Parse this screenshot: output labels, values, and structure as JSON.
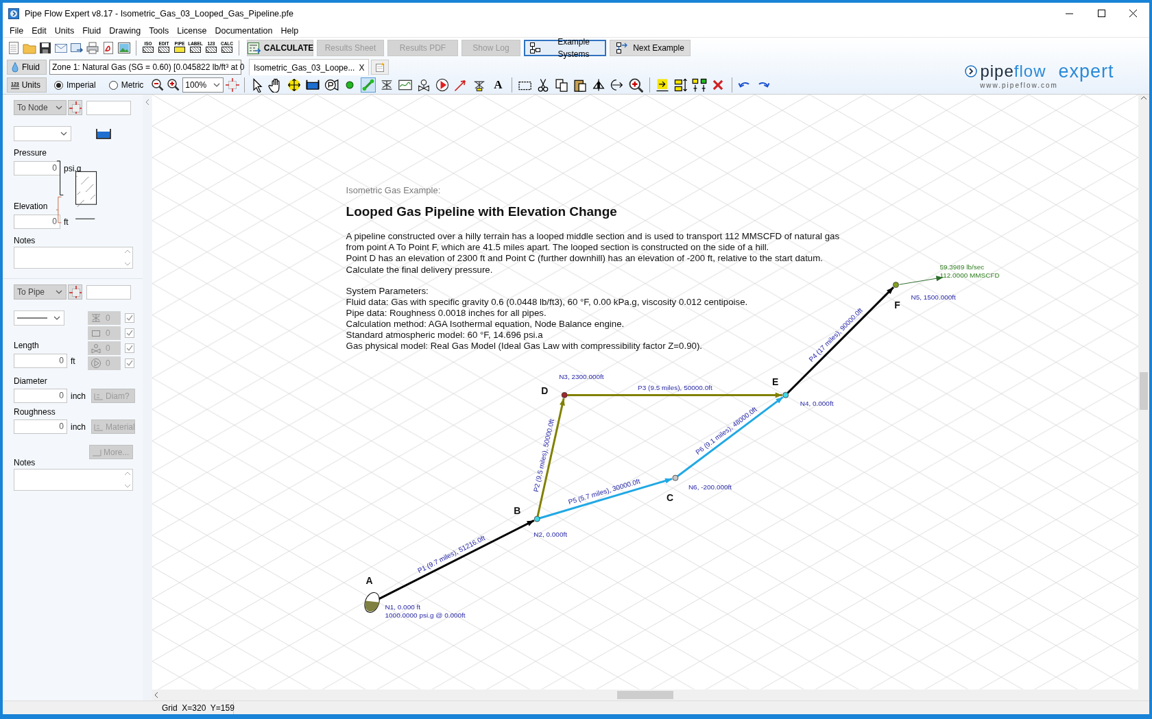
{
  "window": {
    "title": "Pipe Flow Expert v8.17 - Isometric_Gas_03_Looped_Gas_Pipeline.pfe"
  },
  "menu": [
    "File",
    "Edit",
    "Units",
    "Fluid",
    "Drawing",
    "Tools",
    "License",
    "Documentation",
    "Help"
  ],
  "toolbar": {
    "file_tools": [
      {
        "kind": "new"
      },
      {
        "kind": "open"
      },
      {
        "kind": "save"
      },
      {
        "kind": "email"
      },
      {
        "kind": "export"
      },
      {
        "kind": "print"
      },
      {
        "kind": "pdf"
      },
      {
        "kind": "image"
      }
    ],
    "mode_tools": [
      "ISO",
      "EDIT",
      "PIPE",
      "LABEL",
      "123",
      "CALC"
    ],
    "buttons": [
      {
        "label": "CALCULATE",
        "kind": "calculate",
        "disabled": false,
        "focused": false
      },
      {
        "label": "Results Sheet",
        "kind": "plain",
        "disabled": true,
        "focused": false
      },
      {
        "label": "Results PDF",
        "kind": "plain",
        "disabled": true,
        "focused": false
      },
      {
        "label": "Show Log",
        "kind": "plain",
        "disabled": true,
        "focused": false
      },
      {
        "label": "Example Systems",
        "kind": "systems",
        "disabled": false,
        "focused": true
      },
      {
        "label": "Next Example",
        "kind": "next",
        "disabled": false,
        "focused": false
      }
    ]
  },
  "fluid_bar": {
    "button": "Fluid",
    "zone": "Zone 1: Natural Gas (SG = 0.60) [0.045822 lb/ft³ at 0"
  },
  "tabs": [
    {
      "label": "Isometric_Gas_03_Loope...",
      "close": "X",
      "selected": true
    }
  ],
  "units_bar": {
    "icon_text": "123",
    "button": "Units",
    "radios": [
      {
        "label": "Imperial",
        "selected": true
      },
      {
        "label": "Metric",
        "selected": false
      }
    ],
    "zoom": "100%"
  },
  "draw_tools": [
    {
      "kind": "pointer",
      "selected": false
    },
    {
      "kind": "hand",
      "selected": false
    },
    {
      "kind": "move",
      "selected": false
    },
    {
      "kind": "tank",
      "selected": false
    },
    {
      "kind": "compressor",
      "selected": false
    },
    {
      "kind": "node",
      "selected": false
    },
    {
      "kind": "pipe",
      "selected": true
    },
    {
      "kind": "valve",
      "selected": false
    },
    {
      "kind": "curve",
      "selected": false
    },
    {
      "kind": "control",
      "selected": false
    },
    {
      "kind": "pump",
      "selected": false
    },
    {
      "kind": "leader",
      "selected": false
    },
    {
      "kind": "component",
      "selected": false
    },
    {
      "kind": "text",
      "glyph": "A",
      "selected": false
    },
    {
      "kind": "sep"
    },
    {
      "kind": "select",
      "selected": false
    },
    {
      "kind": "cut",
      "selected": false
    },
    {
      "kind": "copy",
      "selected": false
    },
    {
      "kind": "paste",
      "selected": false
    },
    {
      "kind": "flip",
      "selected": false
    },
    {
      "kind": "rotate",
      "selected": false
    },
    {
      "kind": "zoomarea",
      "selected": false
    },
    {
      "kind": "sep"
    },
    {
      "kind": "insert",
      "selected": false
    },
    {
      "kind": "align",
      "selected": false
    },
    {
      "kind": "spread",
      "selected": false
    },
    {
      "kind": "delete",
      "selected": false
    },
    {
      "kind": "sep"
    },
    {
      "kind": "undo",
      "selected": false
    },
    {
      "kind": "redo",
      "selected": false
    }
  ],
  "logo": {
    "part1": "pipe",
    "part2": "flow",
    "part3": "expert",
    "url": "www.pipeflow.com"
  },
  "node_panel": {
    "mode": "To Node",
    "pressure_label": "Pressure",
    "pressure": "0",
    "pressure_unit": "psi.g",
    "elevation_label": "Elevation",
    "elevation": "0",
    "elevation_unit": "ft",
    "notes_label": "Notes"
  },
  "pipe_panel": {
    "mode": "To Pipe",
    "fittings": [
      {
        "kind": "valve",
        "count": "0",
        "checked": true
      },
      {
        "kind": "fitting",
        "count": "0",
        "checked": true
      },
      {
        "kind": "control",
        "count": "0",
        "checked": true
      },
      {
        "kind": "pump",
        "count": "0",
        "checked": true
      }
    ],
    "length_label": "Length",
    "length": "0",
    "length_unit": "ft",
    "diameter_label": "Diameter",
    "diameter": "0",
    "diameter_unit": "inch",
    "diam_button": "Diam?",
    "roughness_label": "Roughness",
    "roughness": "0",
    "roughness_unit": "inch",
    "material_button": "Material",
    "more_button": "More...",
    "notes_label": "Notes"
  },
  "diagram": {
    "intro": "Isometric Gas Example:",
    "heading": "Looped Gas Pipeline with Elevation Change",
    "description": [
      "A pipeline constructed over a hilly terrain has a looped middle section and is used to transport 112 MMSCFD of natural gas",
      "from point A To Point F, which are 41.5 miles apart. The looped section is constructed on the side of a hill.",
      "Point D has an elevation of 2300 ft and Point C (further downhill) has an elevation of -200 ft, relative to the start datum.",
      "Calculate the final delivery pressure."
    ],
    "params_heading": "System Parameters:",
    "params": [
      "Fluid data: Gas with specific gravity 0.6 (0.0448 lb/ft3), 60 °F, 0.00 kPa.g, viscosity 0.012 centipoise.",
      "Pipe data: Roughness 0.0018 inches for all pipes.",
      "Calculation method: AGA Isothermal equation, Node Balance engine.",
      "Standard atmospheric model: 60 °F, 14.696 psi.a",
      "Gas physical model: Real Gas Model (Ideal Gas Law with compressibility factor Z=0.90)."
    ],
    "nodes": [
      {
        "kind": "tank",
        "letter": "A",
        "label": "N1, 0.000 ft",
        "label2": "1000.0000 psi.g @ 0.000ft",
        "color": "#808040"
      },
      {
        "kind": "node",
        "letter": "B",
        "label": "N2, 0.000ft",
        "color": "#40d8e8"
      },
      {
        "kind": "node",
        "letter": "D",
        "label": "N3, 2300.000ft",
        "color": "#a02828"
      },
      {
        "kind": "node",
        "letter": "E",
        "label": "N4, 0.000ft",
        "color": "#40d8e8"
      },
      {
        "kind": "node",
        "letter": "F",
        "label": "N5, 1500.000ft",
        "color": "#80a020"
      },
      {
        "kind": "node",
        "letter": "C",
        "label": "N6, -200.000ft",
        "color": "#c8c8c8"
      }
    ],
    "pipes": [
      {
        "label": "P1 (9.7 miles), 51216.0ft",
        "color": "#000000"
      },
      {
        "label": "P2 (9.5 miles), 50000.0ft",
        "color": "#808000"
      },
      {
        "label": "P3 (9.5 miles), 50000.0ft",
        "color": "#808000"
      },
      {
        "label": "P4 (17 miles), 90000.0ft",
        "color": "#000000"
      },
      {
        "label": "P5 (5.7 miles), 30000.0ft",
        "color": "#20a8e4"
      },
      {
        "label": "P6 (9.1 miles), 48000.0ft",
        "color": "#20a8e4"
      }
    ],
    "output": [
      "59.3989 lb/sec",
      "112.0000 MMSCFD"
    ]
  },
  "status_bar": "Grid  X=320  Y=159"
}
